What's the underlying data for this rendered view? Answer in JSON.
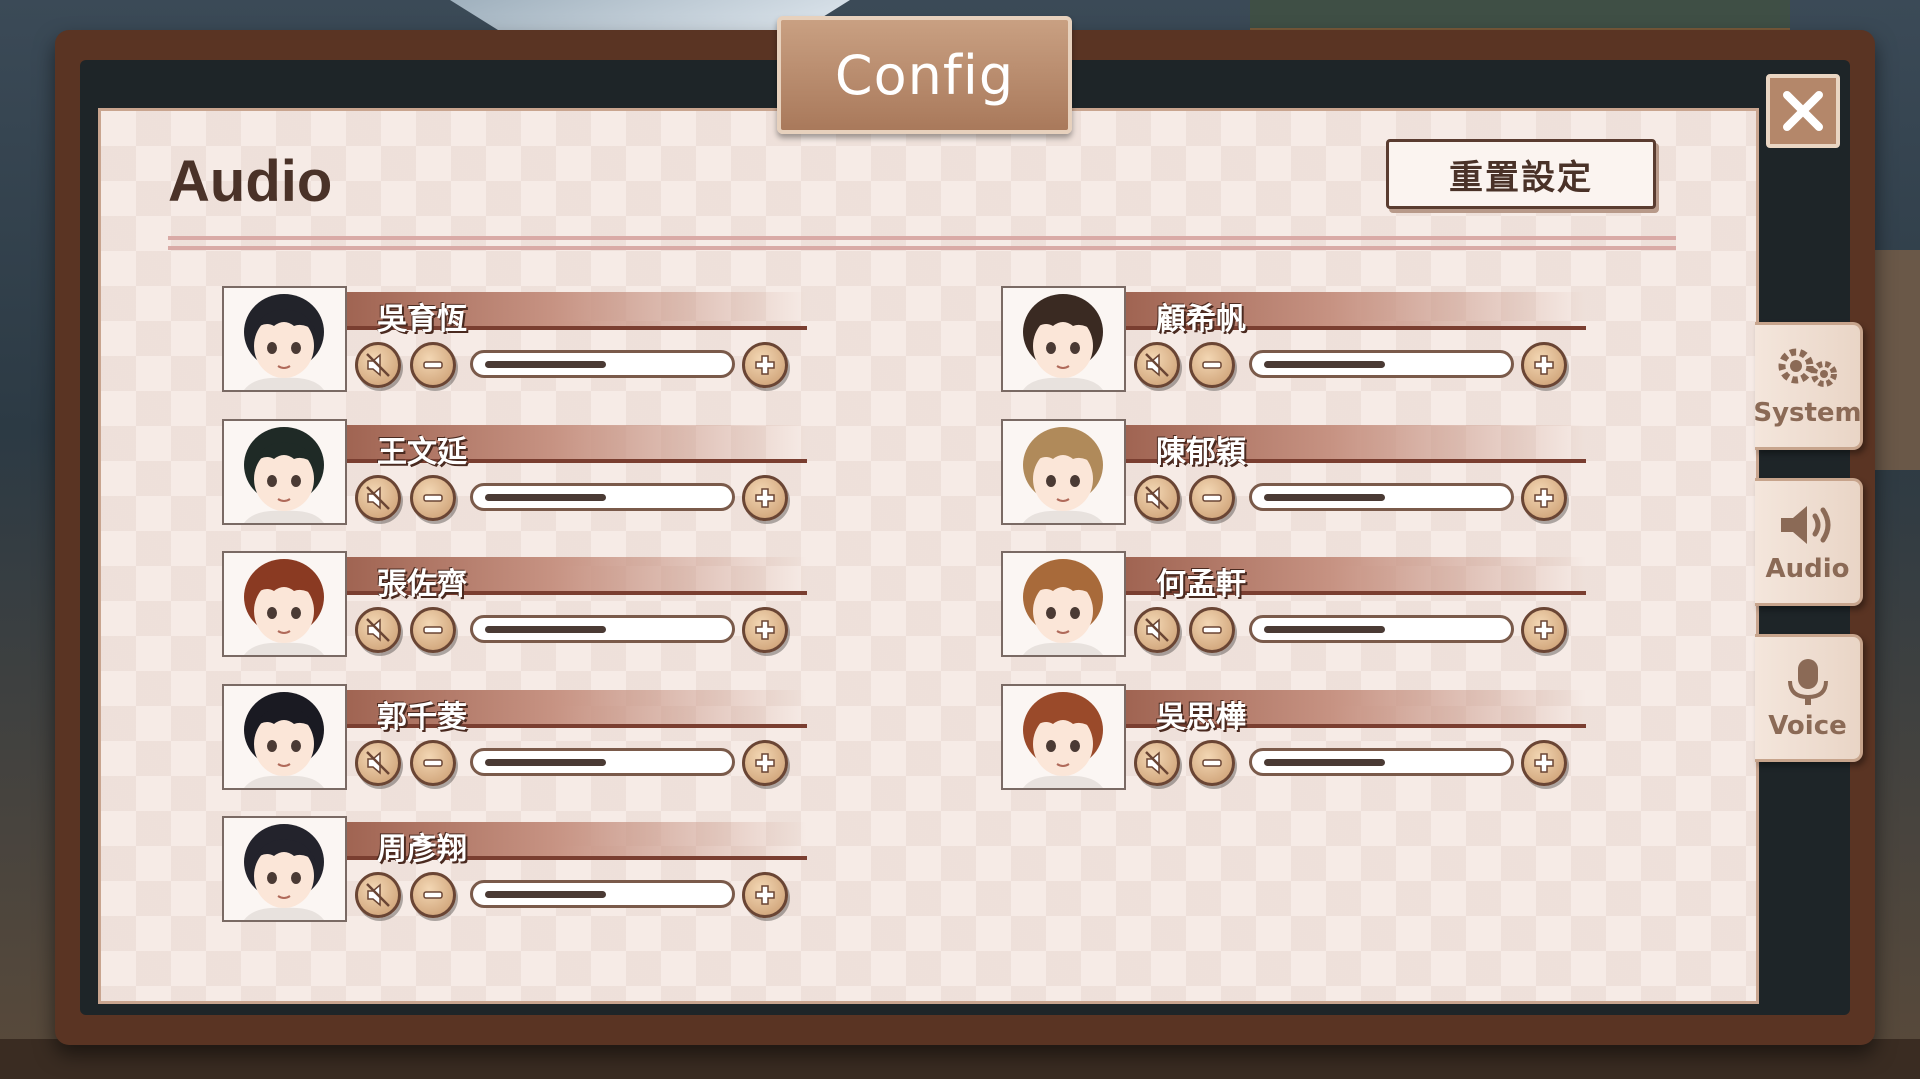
{
  "window": {
    "title": "Config",
    "close_label": "✕"
  },
  "section": {
    "title": "Audio",
    "reset_label": "重置設定"
  },
  "side_tabs": [
    {
      "label": "System",
      "icon": "gears-icon"
    },
    {
      "label": "Audio",
      "icon": "speaker-icon"
    },
    {
      "label": "Voice",
      "icon": "microphone-icon"
    }
  ],
  "characters": [
    {
      "name": "吳育恆",
      "volume": 0.5
    },
    {
      "name": "王文延",
      "volume": 0.5
    },
    {
      "name": "張佐齊",
      "volume": 0.5
    },
    {
      "name": "郭千菱",
      "volume": 0.5
    },
    {
      "name": "周彥翔",
      "volume": 0.5
    },
    {
      "name": "顧希帆",
      "volume": 0.5
    },
    {
      "name": "陳郁穎",
      "volume": 0.5
    },
    {
      "name": "何孟軒",
      "volume": 0.5
    },
    {
      "name": "吳思樺",
      "volume": 0.5
    }
  ],
  "colors": {
    "accent": "#a06452",
    "panel": "#f6ebe6",
    "frame": "#5a3423"
  }
}
